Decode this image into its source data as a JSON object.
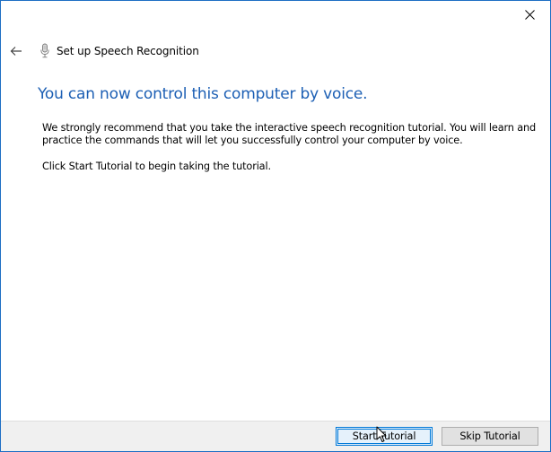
{
  "window": {
    "title": "Set up Speech Recognition"
  },
  "controls": {
    "close_icon": "close-icon",
    "back_icon": "back-arrow-icon",
    "app_icon": "microphone-icon"
  },
  "content": {
    "heading": "You can now control this computer by voice.",
    "paragraph1_line1": "We strongly recommend that you take the interactive speech recognition tutorial. You will learn and",
    "paragraph1_line2": "practice the commands that will let you successfully control your computer by voice.",
    "paragraph2": "Click Start Tutorial to begin taking the tutorial."
  },
  "footer": {
    "start_label": "Start Tutorial",
    "skip_label": "Skip Tutorial"
  },
  "colors": {
    "heading": "#1c5fb4",
    "window_border": "#1e6fc4",
    "footer_bg": "#f0f0f0",
    "default_button_border": "#0078d7"
  }
}
